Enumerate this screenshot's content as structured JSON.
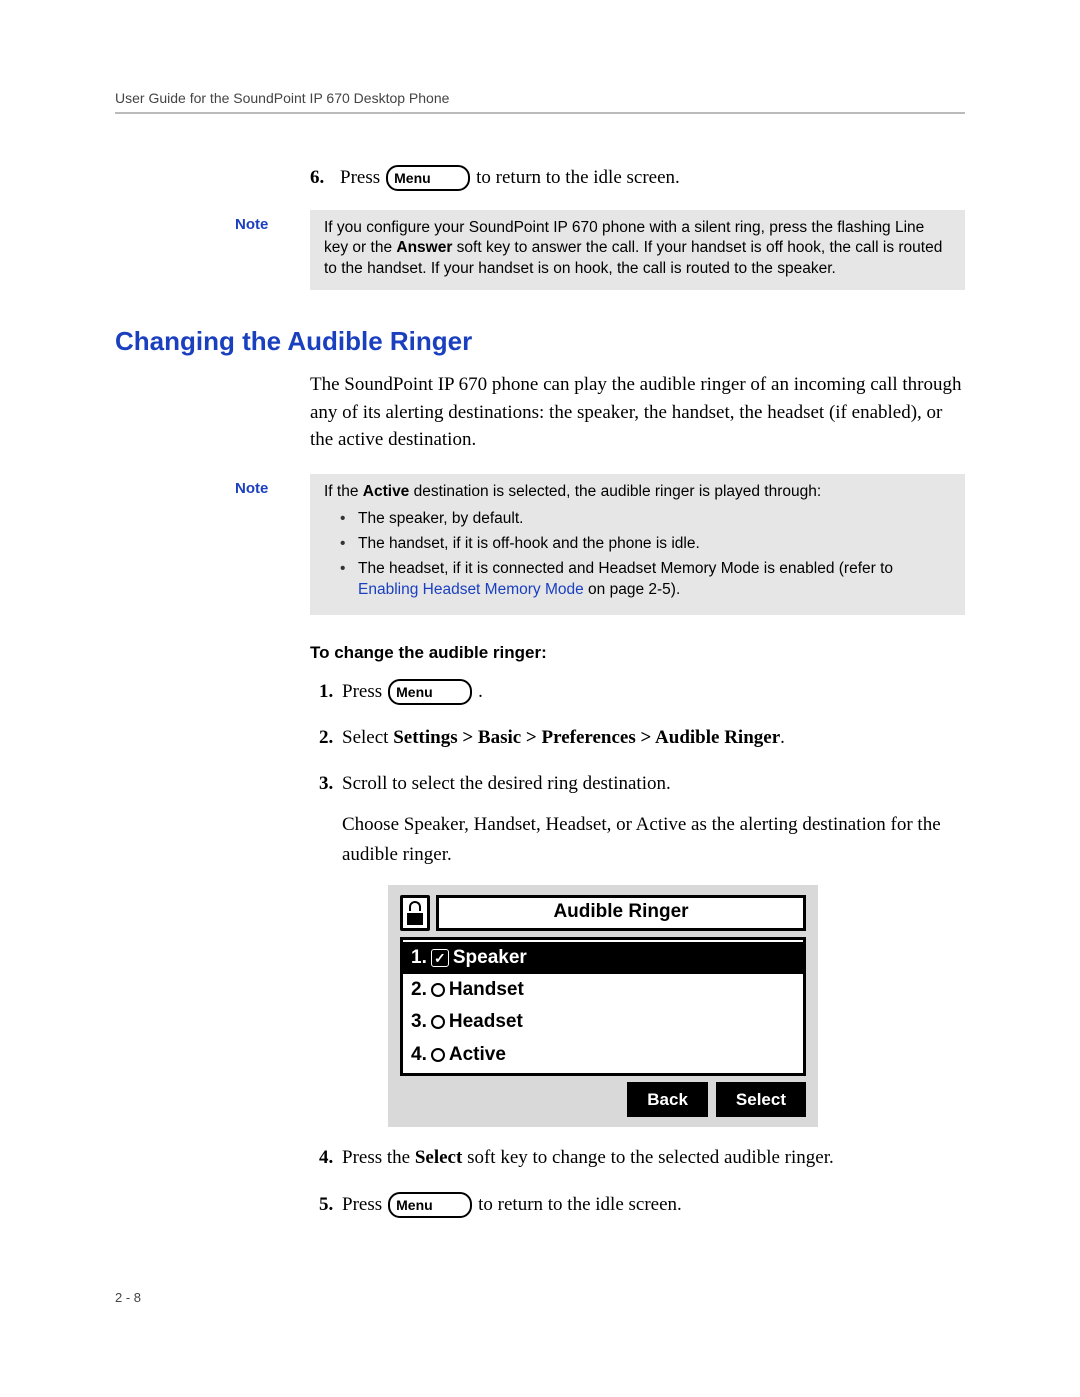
{
  "header": {
    "title": "User Guide for the SoundPoint IP 670 Desktop Phone"
  },
  "button": {
    "menu": "Menu"
  },
  "prev_step": {
    "num": "6.",
    "pre": "Press",
    "post": "to return to the idle screen."
  },
  "note1": {
    "label": "Note",
    "text_pre": "If you configure your SoundPoint IP 670 phone with a silent ring, press the flashing Line key or the ",
    "bold1": "Answer",
    "text_post": " soft key to answer the call. If your handset is off hook, the call is routed to the handset. If your handset is on hook, the call is routed to the speaker."
  },
  "section": {
    "title": "Changing the Audible Ringer"
  },
  "intro": "The SoundPoint IP 670 phone can play the audible ringer of an incoming call through any of its alerting destinations: the speaker, the handset, the headset (if enabled), or the active destination.",
  "note2": {
    "label": "Note",
    "lead_pre": "If the ",
    "lead_b": "Active",
    "lead_post": " destination is selected, the audible ringer is played through:",
    "b1": "The speaker, by default.",
    "b2": "The handset, if it is off-hook and the phone is idle.",
    "b3_pre": "The headset, if it is connected and Headset Memory Mode is enabled (refer to ",
    "b3_link": "Enabling Headset Memory Mode",
    "b3_post": " on page 2-5)."
  },
  "subhead": "To change the audible ringer:",
  "steps": {
    "s1_pre": "Press",
    "s1_post": ".",
    "s2_pre": "Select ",
    "s2_b": "Settings > Basic > Preferences > Audible Ringer",
    "s2_post": ".",
    "s3": "Scroll to select the desired ring destination.",
    "s3_cont": "Choose Speaker, Handset, Headset, or Active as the alerting destination for the audible ringer.",
    "s4_pre": "Press the ",
    "s4_b": "Select",
    "s4_post": " soft key to change to the selected audible ringer.",
    "s5_pre": "Press",
    "s5_post": "to return to the idle screen."
  },
  "lcd": {
    "title": "Audible Ringer",
    "items": [
      {
        "n": "1.",
        "label": "Speaker",
        "selected": true
      },
      {
        "n": "2.",
        "label": "Handset",
        "selected": false
      },
      {
        "n": "3.",
        "label": "Headset",
        "selected": false
      },
      {
        "n": "4.",
        "label": "Active",
        "selected": false
      }
    ],
    "back": "Back",
    "select": "Select"
  },
  "footer": {
    "page": "2 - 8"
  }
}
